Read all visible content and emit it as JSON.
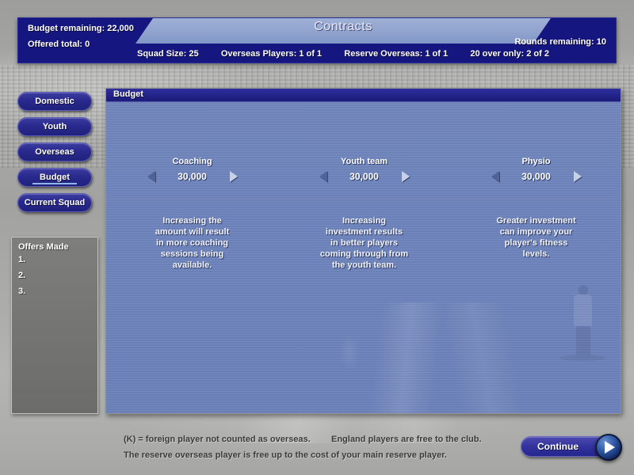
{
  "header": {
    "title": "Contracts",
    "budget_remaining": "Budget remaining: 22,000",
    "offered_total": "Offered total: 0",
    "rounds_remaining": "Rounds remaining: 10",
    "stats": [
      "Squad Size: 25",
      "Overseas Players: 1 of 1",
      "Reserve Overseas: 1 of 1",
      "20 over only: 2 of 2"
    ]
  },
  "nav": {
    "items": [
      {
        "label": "Domestic",
        "active": false
      },
      {
        "label": "Youth",
        "active": false
      },
      {
        "label": "Overseas",
        "active": false
      },
      {
        "label": "Budget",
        "active": true
      },
      {
        "label": "Current Squad",
        "active": false
      }
    ]
  },
  "offers": {
    "title": "Offers Made",
    "rows": [
      "1.",
      "2.",
      "3."
    ]
  },
  "panel": {
    "title": "Budget",
    "columns": [
      {
        "label": "Coaching",
        "value": "30,000",
        "description": "Increasing the\namount will result\nin more coaching\nsessions being\navailable."
      },
      {
        "label": "Youth team",
        "value": "30,000",
        "description": "Increasing\ninvestment results\nin better players\ncoming through from\nthe youth team."
      },
      {
        "label": "Physio",
        "value": "30,000",
        "description": "Greater investment\ncan improve your\nplayer's fitness\nlevels."
      }
    ]
  },
  "footer": {
    "note_1a": "(K) = foreign player not counted as overseas.",
    "note_1b": "England players are free to the club.",
    "note_2": "The reserve overseas player is free up to the cost of your main reserve player.",
    "continue_label": "Continue"
  },
  "colors": {
    "header_blue": "#161680",
    "panel_blue": "#6f85bd",
    "button_blue": "#2a2a8e",
    "backdrop_gray": "#a9a9a7",
    "accent_underline": "#8fb8e8"
  }
}
